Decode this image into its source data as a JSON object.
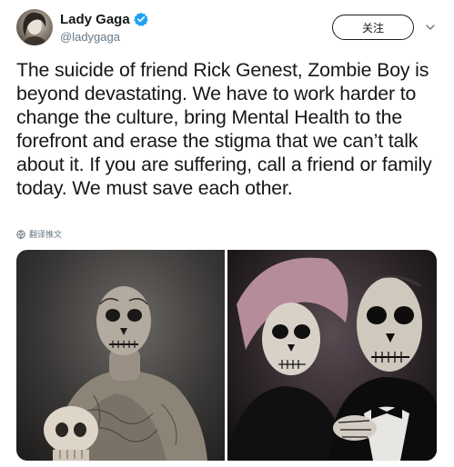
{
  "user": {
    "display_name": "Lady Gaga",
    "handle": "@ladygaga",
    "verified": true,
    "avatar_icon": "profile-photo"
  },
  "actions": {
    "follow_label": "关注",
    "more_icon": "chevron-down-icon"
  },
  "tweet": {
    "text": "The suicide of friend Rick Genest, Zombie Boy is beyond devastating. We have to work harder to change the culture, bring Mental Health to the forefront and erase the stigma that we can’t talk about it. If you are suffering, call a friend or family today. We must save each other.",
    "translate_label": "翻译推文",
    "translate_icon": "globe-icon"
  },
  "media": {
    "photos": [
      {
        "name": "photo-zombie-boy-with-skull"
      },
      {
        "name": "photo-skull-makeup-couple"
      }
    ]
  },
  "colors": {
    "text": "#14171a",
    "secondary_text": "#657786",
    "verified_blue": "#1da1f2",
    "button_border": "#1b1b1b"
  }
}
